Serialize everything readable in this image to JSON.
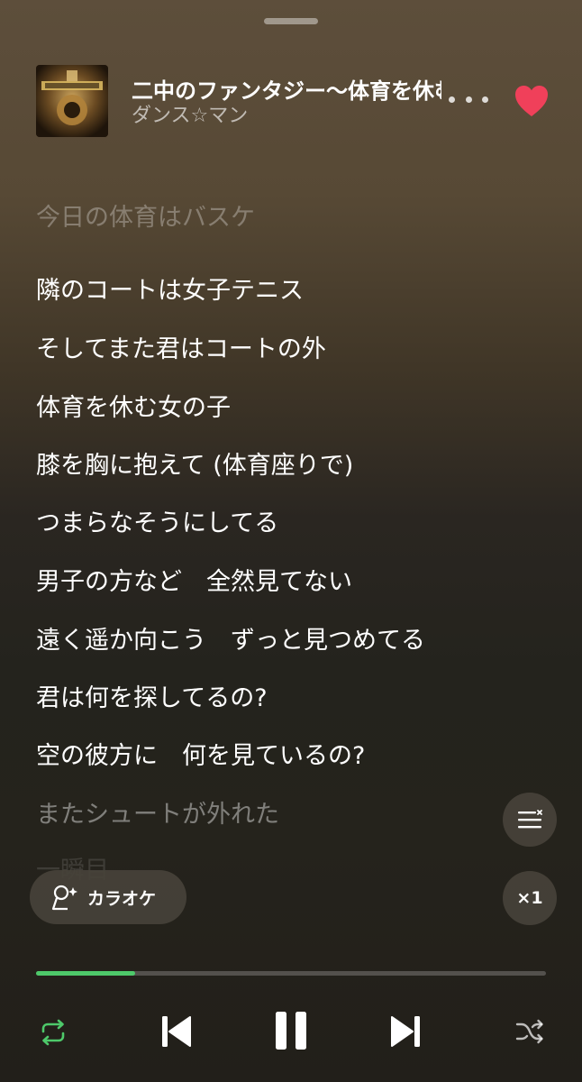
{
  "track": {
    "title": "二中のファンタジー〜体育を休む女の子",
    "artist": "ダンス☆マン",
    "liked": true
  },
  "lyrics": [
    {
      "text": "今日の体育はバスケ",
      "state": "past"
    },
    {
      "text": "隣のコートは女子テニス",
      "state": "current"
    },
    {
      "text": "そしてまた君はコートの外",
      "state": "current"
    },
    {
      "text": "体育を休む女の子",
      "state": "current"
    },
    {
      "text": "膝を胸に抱えて (体育座りで)",
      "state": "current"
    },
    {
      "text": "つまらなそうにしてる",
      "state": "current"
    },
    {
      "text": "男子の方など　全然見てない",
      "state": "current"
    },
    {
      "text": "遠く遥か向こう　ずっと見つめてる",
      "state": "current"
    },
    {
      "text": "君は何を探してるの?",
      "state": "current"
    },
    {
      "text": "空の彼方に　何を見ているの?",
      "state": "current"
    },
    {
      "text": "またシュートが外れた",
      "state": "upcoming"
    },
    {
      "text": "一瞬目",
      "state": "upcoming-faint"
    }
  ],
  "buttons": {
    "karaoke_label": "カラオケ",
    "speed_label": "×1"
  },
  "playback": {
    "progress": 0.195,
    "is_playing": true,
    "repeat_active": true,
    "shuffle_active": false
  },
  "colors": {
    "accent_green": "#4ec96a",
    "heart_red": "#f0405a"
  },
  "icons": {
    "more": "more-horizontal-icon",
    "like": "heart-icon",
    "queue": "queue-icon",
    "karaoke": "microphone-icon",
    "repeat": "repeat-icon",
    "previous": "skip-previous-icon",
    "pause": "pause-icon",
    "next": "skip-next-icon",
    "shuffle": "shuffle-icon"
  }
}
